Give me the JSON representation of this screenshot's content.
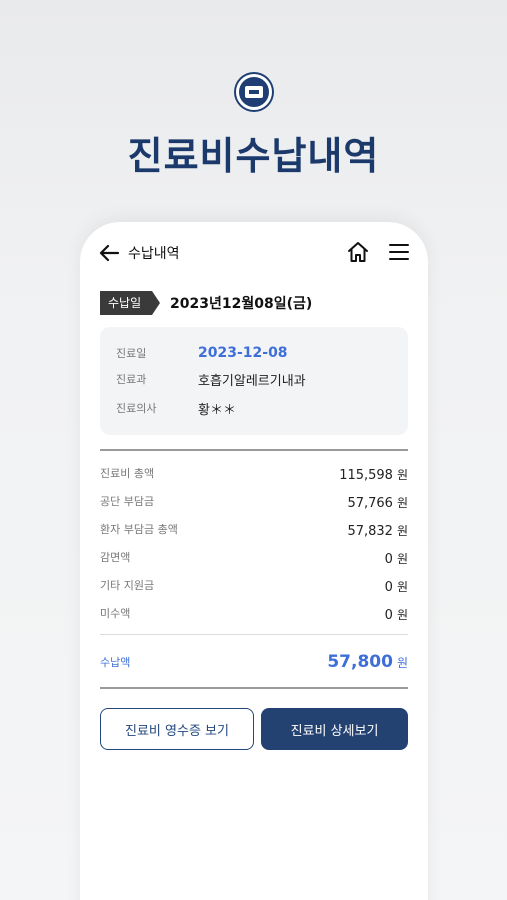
{
  "hero": {
    "title": "진료비수납내역"
  },
  "nav": {
    "title": "수납내역"
  },
  "payment": {
    "tag": "수납일",
    "date": "2023년12월08일(금)"
  },
  "info": [
    {
      "label": "진료일",
      "value": "2023-12-08"
    },
    {
      "label": "진료과",
      "value": "호흡기알레르기내과"
    },
    {
      "label": "진료의사",
      "value": "황＊＊"
    }
  ],
  "fees": [
    {
      "label": "진료비 총액",
      "value": "115,598",
      "unit": "원"
    },
    {
      "label": "공단 부담금",
      "value": "57,766",
      "unit": "원"
    },
    {
      "label": "환자 부담금 총액",
      "value": "57,832",
      "unit": "원"
    },
    {
      "label": "감면액",
      "value": "0",
      "unit": "원"
    },
    {
      "label": "기타 지원금",
      "value": "0",
      "unit": "원"
    },
    {
      "label": "미수액",
      "value": "0",
      "unit": "원"
    }
  ],
  "paid": {
    "label": "수납액",
    "value": "57,800",
    "unit": "원"
  },
  "buttons": {
    "receipt": "진료비 영수증 보기",
    "detail": "진료비 상세보기"
  },
  "colors": {
    "brand": "#1b3a6b",
    "accent": "#3e6fd8",
    "button": "#234272"
  }
}
